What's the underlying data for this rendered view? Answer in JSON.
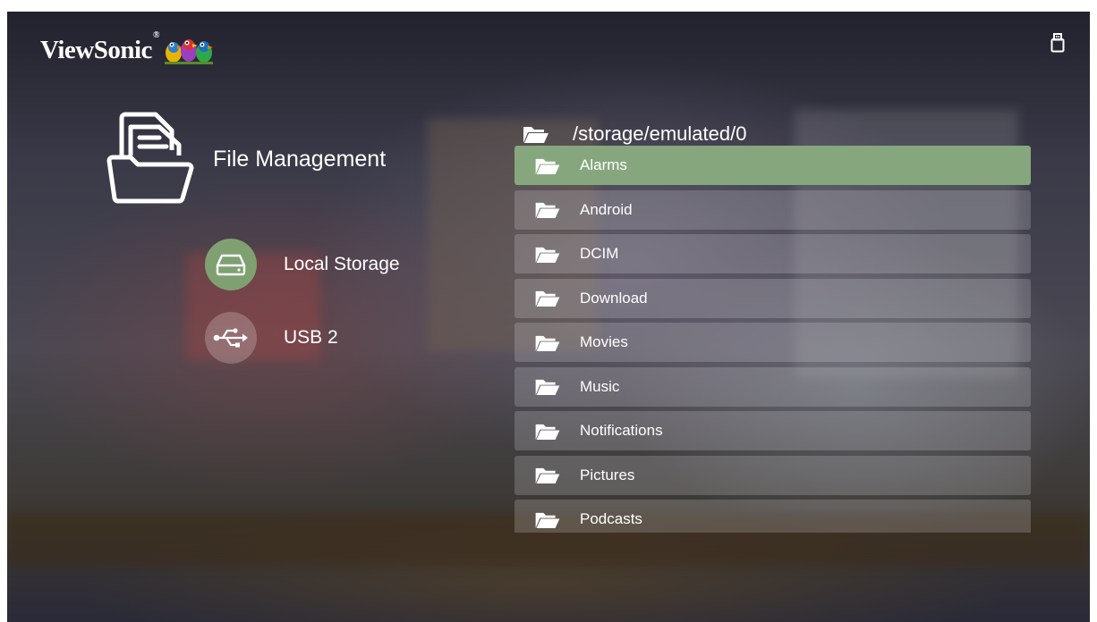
{
  "brand": {
    "name": "ViewSonic",
    "registered": "®"
  },
  "icons": {
    "top_right": "usb-drive-icon",
    "section": "file-management-icon",
    "folder": "folder-icon",
    "local_storage": "hard-drive-icon",
    "usb": "usb-icon"
  },
  "colors": {
    "selected_row": "#86a77d",
    "local_storage_circle": "#7fa172"
  },
  "section": {
    "title": "File Management"
  },
  "storage": [
    {
      "label": "Local Storage",
      "icon": "hard-drive-icon",
      "selected": true
    },
    {
      "label": "USB 2",
      "icon": "usb-icon",
      "selected": false
    }
  ],
  "browser": {
    "path": "/storage/emulated/0",
    "folders": [
      {
        "name": "Alarms",
        "selected": true
      },
      {
        "name": "Android",
        "selected": false
      },
      {
        "name": "DCIM",
        "selected": false
      },
      {
        "name": "Download",
        "selected": false
      },
      {
        "name": "Movies",
        "selected": false
      },
      {
        "name": "Music",
        "selected": false
      },
      {
        "name": "Notifications",
        "selected": false
      },
      {
        "name": "Pictures",
        "selected": false
      },
      {
        "name": "Podcasts",
        "selected": false
      }
    ]
  }
}
